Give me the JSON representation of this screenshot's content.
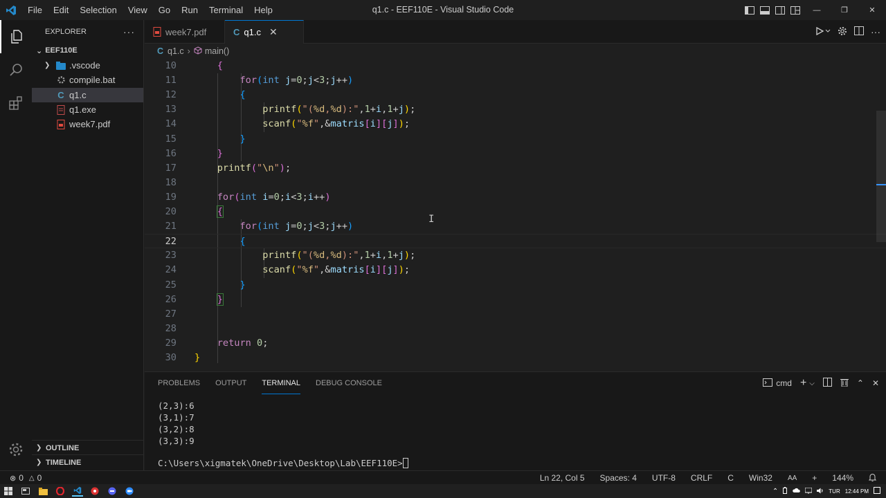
{
  "titlebar": {
    "menu": [
      "File",
      "Edit",
      "Selection",
      "View",
      "Go",
      "Run",
      "Terminal",
      "Help"
    ],
    "window_title": "q1.c - EEF110E - Visual Studio Code"
  },
  "sidebar": {
    "header": "EXPLORER",
    "folder": "EEF110E",
    "files": [
      {
        "name": ".vscode",
        "icon": "vscode-folder-icon"
      },
      {
        "name": "compile.bat",
        "icon": "gear-file-icon"
      },
      {
        "name": "q1.c",
        "icon": "c-file-icon"
      },
      {
        "name": "q1.exe",
        "icon": "exe-file-icon"
      },
      {
        "name": "week7.pdf",
        "icon": "pdf-file-icon"
      }
    ],
    "outline": "OUTLINE",
    "timeline": "TIMELINE"
  },
  "tabs": [
    {
      "label": "week7.pdf",
      "icon": "pdf-file-icon"
    },
    {
      "label": "q1.c",
      "icon": "c-file-icon"
    }
  ],
  "breadcrumb": {
    "file": "q1.c",
    "symbol": "main()"
  },
  "editor": {
    "line_numbers": [
      "10",
      "11",
      "12",
      "13",
      "14",
      "15",
      "16",
      "17",
      "18",
      "19",
      "20",
      "21",
      "22",
      "23",
      "24",
      "25",
      "26",
      "27",
      "28",
      "29",
      "30"
    ],
    "current_line": "22"
  },
  "panel": {
    "tabs": [
      "PROBLEMS",
      "OUTPUT",
      "TERMINAL",
      "DEBUG CONSOLE"
    ],
    "shell": "cmd",
    "terminal_lines": [
      "(2,3):6",
      "(3,1):7",
      "(3,2):8",
      "(3,3):9"
    ],
    "prompt": "C:\\Users\\xigmatek\\OneDrive\\Desktop\\Lab\\EEF110E>"
  },
  "statusbar": {
    "errors": "0",
    "warnings": "0",
    "position": "Ln 22, Col 5",
    "spaces": "Spaces: 4",
    "encoding": "UTF-8",
    "eol": "CRLF",
    "language": "C",
    "platform": "Win32",
    "zoom": "144%"
  },
  "taskbar": {
    "lang": "TUR",
    "time": "12:44 PM"
  },
  "colors": {
    "accent": "#0078d4",
    "vscode_blue": "#2489ca",
    "keyword": "#c586c0",
    "type": "#569cd6",
    "function": "#dcdcaa",
    "string": "#ce9178",
    "number": "#b5cea8"
  }
}
